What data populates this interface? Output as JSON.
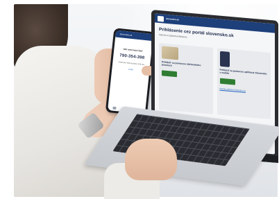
{
  "phone": {
    "app_bar": "Slovensko.sk",
    "title": "Váš overovací kód",
    "code": "790-354-398",
    "small_text": "Overovací kód je platný 3:46 min",
    "link": "Zrušiť"
  },
  "website": {
    "logo_text": "slovensko.sk",
    "title": "Prihlásenie cez portál slovensko.sk",
    "subtitle": "Vyberte si spôsob prihlásenia",
    "card_eid_title": "Prihlásiť sa pomocou občianskeho preukazu",
    "card_app_title": "Prihlásiť sa pomocou aplikácie Slovensko v mobile",
    "card_app_link": "Nemáte aplikáciu? Stiahnite si ju"
  },
  "colors": {
    "header_blue": "#1d3f7a",
    "button_green": "#2f7d32",
    "link_blue": "#1d5fbd"
  }
}
